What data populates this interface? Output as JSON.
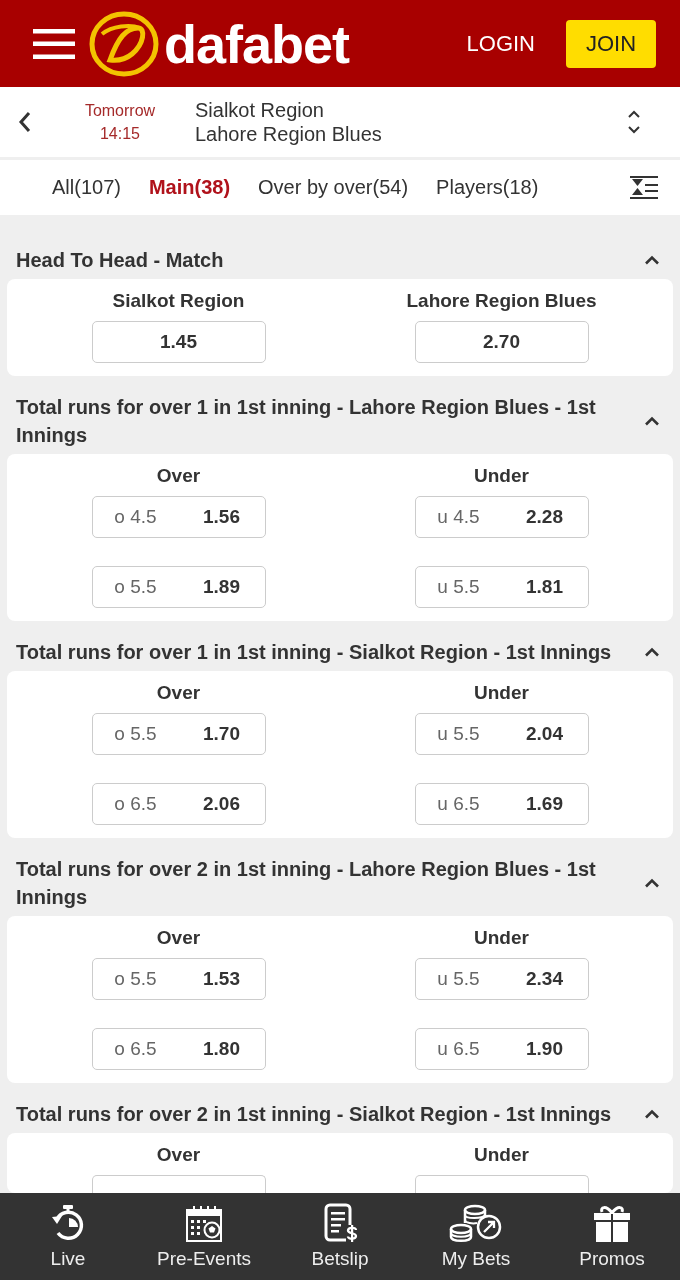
{
  "header": {
    "brand": "dafabet",
    "login": "LOGIN",
    "join": "JOIN"
  },
  "match": {
    "day": "Tomorrow",
    "time": "14:15",
    "teams": [
      "Sialkot Region",
      "Lahore Region Blues"
    ]
  },
  "tabs": [
    {
      "label": "All(107)",
      "selected": false
    },
    {
      "label": "Main(38)",
      "selected": true
    },
    {
      "label": "Over by over(54)",
      "selected": false
    },
    {
      "label": "Players(18)",
      "selected": false
    }
  ],
  "markets": [
    {
      "title": "Head To Head - Match",
      "expanded": true,
      "columns": [
        {
          "header": "Sialkot Region",
          "selections": [
            {
              "odds": "1.45"
            }
          ]
        },
        {
          "header": "Lahore Region Blues",
          "selections": [
            {
              "odds": "2.70"
            }
          ]
        }
      ]
    },
    {
      "title": "Total runs for over 1 in 1st inning - Lahore Region Blues - 1st Innings",
      "expanded": true,
      "columns": [
        {
          "header": "Over",
          "selections": [
            {
              "line": "o 4.5",
              "odds": "1.56"
            },
            {
              "line": "o 5.5",
              "odds": "1.89"
            }
          ]
        },
        {
          "header": "Under",
          "selections": [
            {
              "line": "u 4.5",
              "odds": "2.28"
            },
            {
              "line": "u 5.5",
              "odds": "1.81"
            }
          ]
        }
      ]
    },
    {
      "title": "Total runs for over 1 in 1st inning - Sialkot Region - 1st Innings",
      "expanded": true,
      "columns": [
        {
          "header": "Over",
          "selections": [
            {
              "line": "o 5.5",
              "odds": "1.70"
            },
            {
              "line": "o 6.5",
              "odds": "2.06"
            }
          ]
        },
        {
          "header": "Under",
          "selections": [
            {
              "line": "u 5.5",
              "odds": "2.04"
            },
            {
              "line": "u 6.5",
              "odds": "1.69"
            }
          ]
        }
      ]
    },
    {
      "title": "Total runs for over 2 in 1st inning - Lahore Region Blues - 1st Innings",
      "expanded": true,
      "columns": [
        {
          "header": "Over",
          "selections": [
            {
              "line": "o 5.5",
              "odds": "1.53"
            },
            {
              "line": "o 6.5",
              "odds": "1.80"
            }
          ]
        },
        {
          "header": "Under",
          "selections": [
            {
              "line": "u 5.5",
              "odds": "2.34"
            },
            {
              "line": "u 6.5",
              "odds": "1.90"
            }
          ]
        }
      ]
    },
    {
      "title": "Total runs for over 2 in 1st inning - Sialkot Region - 1st Innings",
      "expanded": true,
      "cut_off": true,
      "columns": [
        {
          "header": "Over"
        },
        {
          "header": "Under"
        }
      ]
    }
  ],
  "bottom_nav": [
    {
      "label": "Live"
    },
    {
      "label": "Pre-Events"
    },
    {
      "label": "Betslip"
    },
    {
      "label": "My Bets"
    },
    {
      "label": "Promos"
    }
  ]
}
